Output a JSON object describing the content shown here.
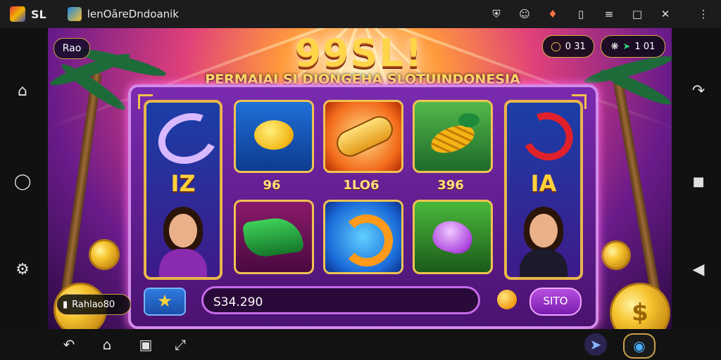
{
  "topbar": {
    "app_name": "SL",
    "tab_title": "lenOāreDndoanik",
    "icons": [
      "shield-icon",
      "face-icon",
      "badge-icon",
      "phone-icon",
      "sliders-icon",
      "window-icon",
      "close-icon",
      "more-icon"
    ]
  },
  "game": {
    "title": "99SL!",
    "subtitle": "PERMAIAI SI DIONGEHA SLOTUINDONESIA",
    "back_label": "Rao",
    "counter_left": "0 31",
    "counter_right": "1 01",
    "balance_label": "Rahlao80",
    "amount_value": "S34.290",
    "spin_label": "SITO",
    "left_reel_label": "IZ",
    "right_reel_label": "IA",
    "tile_values": [
      "96",
      "1LO6",
      "396"
    ]
  },
  "colors": {
    "accent_gold": "#f2c14e",
    "machine_purple": "#7a2bb0",
    "button_blue": "#2f7be0"
  },
  "side_icons": {
    "left": [
      "home-icon",
      "circle-icon",
      "gear-icon"
    ],
    "right": [
      "pin-icon",
      "square-icon",
      "back-triangle-icon"
    ]
  },
  "bottom_icons": [
    "back-icon",
    "home-icon",
    "recent-icon",
    "expand-icon",
    "pin-icon",
    "app-icon"
  ]
}
